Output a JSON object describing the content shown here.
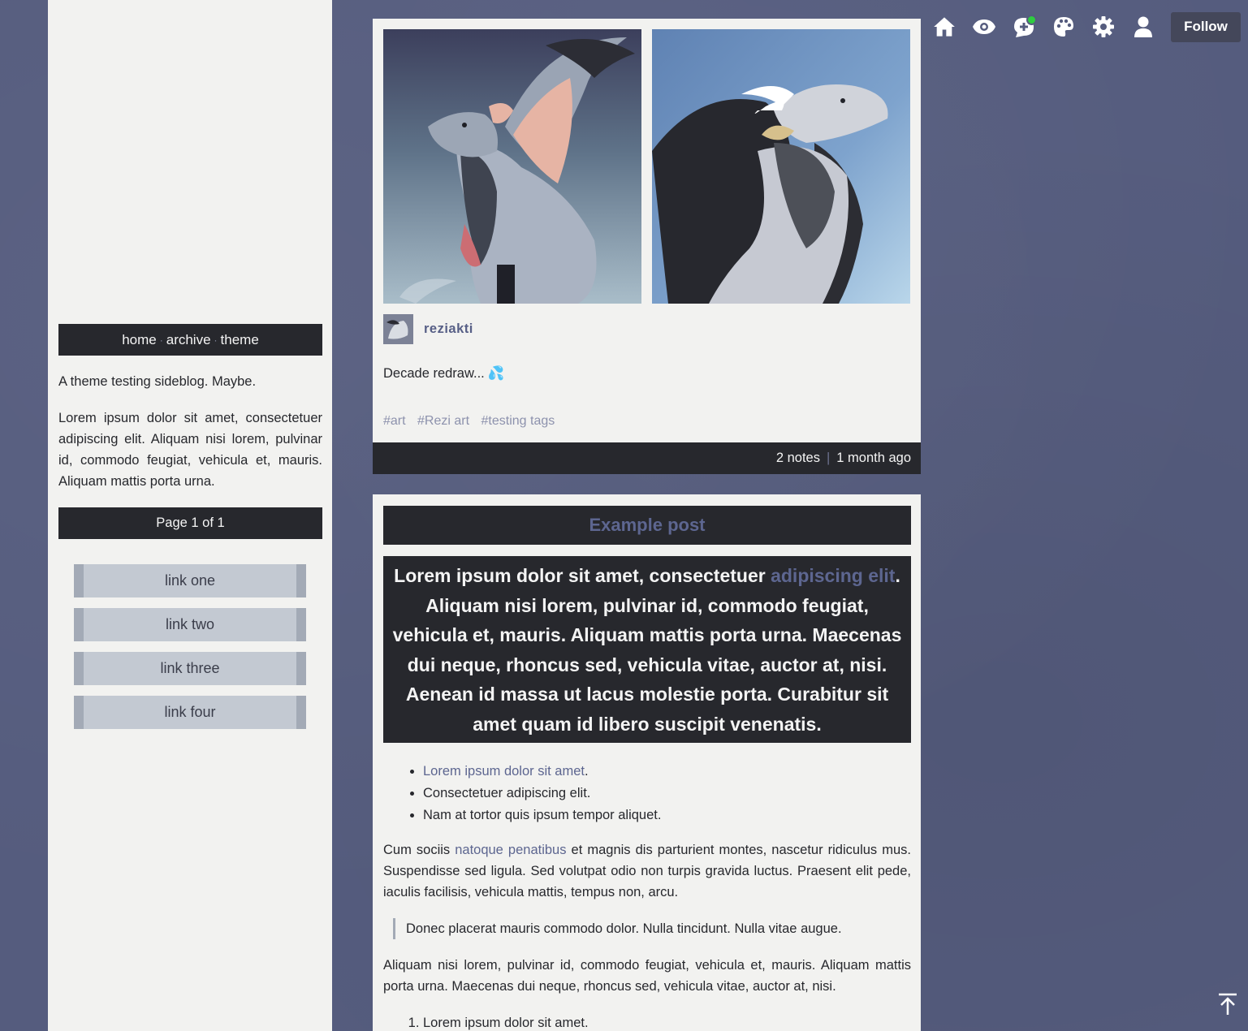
{
  "sidebar": {
    "nav": {
      "home": "home",
      "archive": "archive",
      "theme": "theme",
      "separator": "·"
    },
    "description": [
      "A theme testing sideblog. Maybe.",
      "Lorem ipsum dolor sit amet, consectetuer adipiscing elit. Aliquam nisi lorem, pulvinar id, commodo feugiat, vehicula et, mauris. Aliquam mattis porta urna."
    ],
    "pager": "Page 1 of 1",
    "links": [
      "link one",
      "link two",
      "link three",
      "link four"
    ]
  },
  "post1": {
    "author": "reziakti",
    "caption": "Decade redraw...",
    "caption_emoji": "💦",
    "tags": [
      "#art",
      "#Rezi art",
      "#testing tags"
    ],
    "notes": "2 notes",
    "divider": "|",
    "time": "1 month ago"
  },
  "post2": {
    "title": "Example post",
    "quote_pre": "Lorem ipsum dolor sit amet, consectetuer ",
    "quote_link": "adipiscing elit",
    "quote_post": ". Aliquam nisi lorem, pulvinar id, commodo feugiat, vehicula et, mauris. Aliquam mattis porta urna. Maecenas dui neque, rhoncus sed, vehicula vitae, auctor at, nisi. Aenean id massa ut lacus molestie porta. Curabitur sit amet quam id libero suscipit venenatis.",
    "bullet1_link": "Lorem ipsum dolor sit amet",
    "bullet1_post": ".",
    "bullet2": "Consectetuer adipiscing elit.",
    "bullet3": "Nam at tortor quis ipsum tempor aliquet.",
    "para1_pre": "Cum sociis ",
    "para1_link": "natoque penatibus",
    "para1_post": " et magnis dis parturient montes, nascetur ridiculus mus. Suspendisse sed ligula. Sed volutpat odio non turpis gravida luctus. Praesent elit pede, iaculis facilisis, vehicula mattis, tempus non, arcu.",
    "blockquote": "Donec placerat mauris commodo dolor. Nulla tincidunt. Nulla vitae augue.",
    "para2": "Aliquam nisi lorem, pulvinar id, commodo feugiat, vehicula et, mauris. Aliquam mattis porta urna. Maecenas dui neque, rhoncus sed, vehicula vitae, auctor at, nisi.",
    "olist1": "Lorem ipsum dolor sit amet."
  },
  "controls": {
    "icons": [
      "home-icon",
      "eye-icon",
      "chat-add-icon",
      "palette-icon",
      "gear-icon",
      "user-icon"
    ],
    "follow": "Follow",
    "notification_color": "#2ecc40"
  },
  "colors": {
    "background": "#555c7e",
    "panel": "#f2f2f0",
    "dark_bar": "#27282d",
    "accent": "#5d6690"
  }
}
